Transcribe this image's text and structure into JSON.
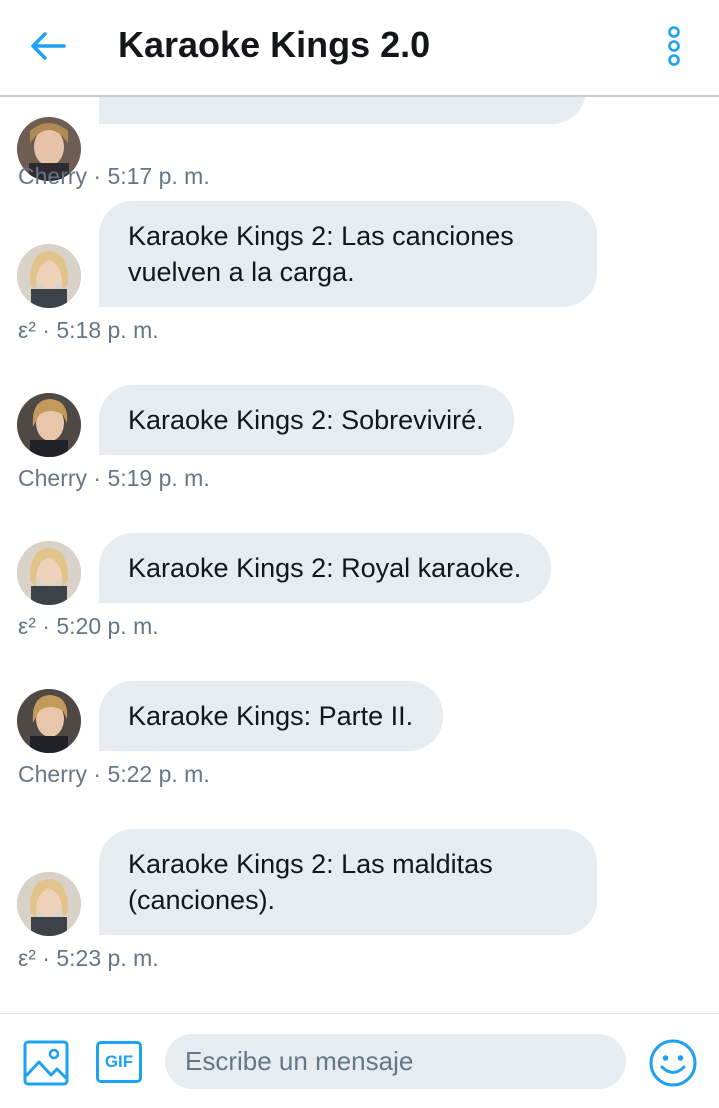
{
  "header": {
    "title": "Karaoke Kings 2.0",
    "back_icon": "arrow-left-icon",
    "more_icon": "more-vertical-icon"
  },
  "messages": [
    {
      "text": "",
      "author": "Cherry",
      "time": "5:17 p. m.",
      "meta": "Cherry · 5:17 p. m."
    },
    {
      "text": "Karaoke Kings 2: Las canciones vuelven a la carga.",
      "author": "ε²",
      "time": "5:18 p. m.",
      "meta": "ε² · 5:18 p. m."
    },
    {
      "text": "Karaoke Kings 2: Sobreviviré.",
      "author": "Cherry",
      "time": "5:19 p. m.",
      "meta": "Cherry · 5:19 p. m."
    },
    {
      "text": "Karaoke Kings 2: Royal karaoke.",
      "author": "ε²",
      "time": "5:20 p. m.",
      "meta": "ε² · 5:20 p. m."
    },
    {
      "text": "Karaoke Kings: Parte II.",
      "author": "Cherry",
      "time": "5:22 p. m.",
      "meta": "Cherry · 5:22 p. m."
    },
    {
      "text": "Karaoke Kings 2: Las malditas (canciones).",
      "author": "ε²",
      "time": "5:23 p. m.",
      "meta": "ε² · 5:23 p. m."
    }
  ],
  "composer": {
    "placeholder": "Escribe un mensaje",
    "gif_label": "GIF",
    "media_icon": "image-icon",
    "emoji_icon": "smiley-icon"
  },
  "colors": {
    "accent": "#1da1f2",
    "bubble": "#e6ecf0",
    "meta_text": "#657786",
    "title_text": "#14171a"
  }
}
